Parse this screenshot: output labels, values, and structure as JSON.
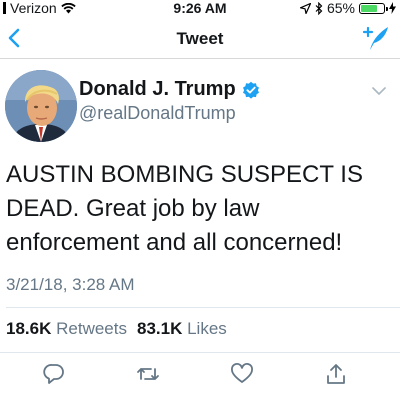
{
  "status_bar": {
    "carrier": "Verizon",
    "time": "9:26 AM",
    "battery_percent": "65%",
    "battery_level": 0.65
  },
  "nav": {
    "title": "Tweet"
  },
  "tweet": {
    "display_name": "Donald J. Trump",
    "handle": "@realDonaldTrump",
    "text": "AUSTIN BOMBING SUSPECT IS DEAD. Great job by law enforcement and all concerned!",
    "timestamp": "3/21/18, 3:28 AM",
    "retweets_count": "18.6K",
    "retweets_label": "Retweets",
    "likes_count": "83.1K",
    "likes_label": "Likes"
  },
  "colors": {
    "accent": "#1da1f2",
    "secondary_text": "#657786",
    "battery_fill": "#4cd964"
  },
  "icons": {
    "back": "chevron-left-icon",
    "compose": "compose-feather-icon",
    "verified": "verified-badge-icon",
    "more": "chevron-down-icon",
    "reply": "reply-icon",
    "retweet": "retweet-icon",
    "like": "heart-icon",
    "share": "share-icon"
  }
}
